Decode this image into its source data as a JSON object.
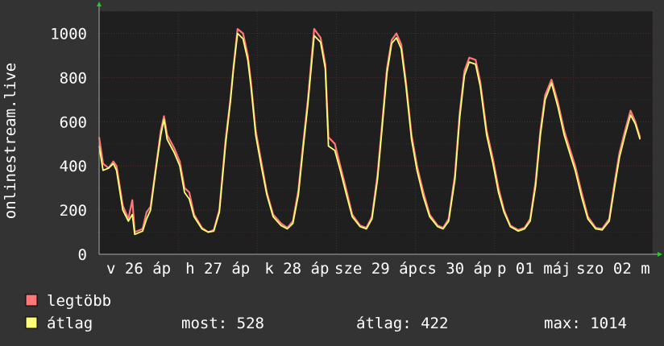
{
  "colors": {
    "background": "#333333",
    "plot_background": "#1f1f1f",
    "grid": "#5a2a2a",
    "text": "#ffffff",
    "axis_arrow": "#22cc22",
    "max_series": "#ff7777",
    "avg_series": "#ffff77"
  },
  "chart_data": {
    "type": "line",
    "ylabel": "onlinestream.live",
    "ylim": [
      0,
      1100
    ],
    "yticks": [
      "0",
      "200",
      "400",
      "600",
      "800",
      "1000"
    ],
    "xlim": [
      0,
      7
    ],
    "xtick_labels": [
      "v 26 áp",
      "h 27 áp",
      "k 28 áp",
      "sze 29 áp",
      "cs 30 áp",
      "p 01 máj",
      "szo 02 m"
    ],
    "grid": true,
    "legend_placement": "bottom",
    "series": [
      {
        "name": "legtöbb",
        "color": "#ff7777",
        "points": [
          [
            0,
            530
          ],
          [
            0.05,
            410
          ],
          [
            0.12,
            390
          ],
          [
            0.18,
            420
          ],
          [
            0.22,
            400
          ],
          [
            0.3,
            220
          ],
          [
            0.37,
            160
          ],
          [
            0.42,
            245
          ],
          [
            0.45,
            100
          ],
          [
            0.55,
            115
          ],
          [
            0.6,
            190
          ],
          [
            0.65,
            215
          ],
          [
            0.72,
            400
          ],
          [
            0.78,
            560
          ],
          [
            0.82,
            625
          ],
          [
            0.86,
            540
          ],
          [
            0.95,
            480
          ],
          [
            1.02,
            420
          ],
          [
            1.08,
            300
          ],
          [
            1.14,
            280
          ],
          [
            1.2,
            180
          ],
          [
            1.3,
            120
          ],
          [
            1.38,
            100
          ],
          [
            1.45,
            110
          ],
          [
            1.52,
            200
          ],
          [
            1.6,
            520
          ],
          [
            1.66,
            700
          ],
          [
            1.7,
            850
          ],
          [
            1.75,
            1020
          ],
          [
            1.82,
            1000
          ],
          [
            1.88,
            900
          ],
          [
            1.92,
            780
          ],
          [
            1.98,
            560
          ],
          [
            2.05,
            420
          ],
          [
            2.12,
            280
          ],
          [
            2.2,
            180
          ],
          [
            2.3,
            140
          ],
          [
            2.38,
            120
          ],
          [
            2.45,
            150
          ],
          [
            2.52,
            290
          ],
          [
            2.58,
            500
          ],
          [
            2.64,
            700
          ],
          [
            2.72,
            1020
          ],
          [
            2.8,
            980
          ],
          [
            2.86,
            860
          ],
          [
            2.9,
            530
          ],
          [
            2.98,
            500
          ],
          [
            3.05,
            400
          ],
          [
            3.12,
            300
          ],
          [
            3.2,
            180
          ],
          [
            3.3,
            130
          ],
          [
            3.38,
            120
          ],
          [
            3.45,
            170
          ],
          [
            3.52,
            360
          ],
          [
            3.58,
            600
          ],
          [
            3.64,
            840
          ],
          [
            3.7,
            970
          ],
          [
            3.76,
            1000
          ],
          [
            3.82,
            950
          ],
          [
            3.88,
            780
          ],
          [
            3.95,
            540
          ],
          [
            4.02,
            400
          ],
          [
            4.1,
            280
          ],
          [
            4.18,
            180
          ],
          [
            4.28,
            130
          ],
          [
            4.35,
            120
          ],
          [
            4.42,
            160
          ],
          [
            4.5,
            360
          ],
          [
            4.56,
            640
          ],
          [
            4.62,
            830
          ],
          [
            4.68,
            890
          ],
          [
            4.76,
            880
          ],
          [
            4.82,
            780
          ],
          [
            4.9,
            560
          ],
          [
            4.98,
            430
          ],
          [
            5.05,
            300
          ],
          [
            5.12,
            200
          ],
          [
            5.2,
            130
          ],
          [
            5.3,
            110
          ],
          [
            5.38,
            120
          ],
          [
            5.45,
            160
          ],
          [
            5.52,
            330
          ],
          [
            5.58,
            560
          ],
          [
            5.64,
            720
          ],
          [
            5.72,
            790
          ],
          [
            5.8,
            690
          ],
          [
            5.88,
            560
          ],
          [
            5.95,
            480
          ],
          [
            6.02,
            400
          ],
          [
            6.1,
            280
          ],
          [
            6.18,
            170
          ],
          [
            6.28,
            120
          ],
          [
            6.36,
            115
          ],
          [
            6.45,
            160
          ],
          [
            6.52,
            330
          ],
          [
            6.58,
            460
          ],
          [
            6.65,
            560
          ],
          [
            6.72,
            650
          ],
          [
            6.78,
            600
          ],
          [
            6.84,
            528
          ]
        ]
      },
      {
        "name": "átlag",
        "color": "#ffff77",
        "points": [
          [
            0,
            490
          ],
          [
            0.05,
            380
          ],
          [
            0.12,
            390
          ],
          [
            0.18,
            410
          ],
          [
            0.22,
            380
          ],
          [
            0.3,
            200
          ],
          [
            0.37,
            150
          ],
          [
            0.42,
            180
          ],
          [
            0.45,
            90
          ],
          [
            0.55,
            105
          ],
          [
            0.6,
            160
          ],
          [
            0.65,
            200
          ],
          [
            0.72,
            390
          ],
          [
            0.78,
            540
          ],
          [
            0.82,
            610
          ],
          [
            0.86,
            520
          ],
          [
            0.95,
            460
          ],
          [
            1.02,
            400
          ],
          [
            1.08,
            280
          ],
          [
            1.14,
            250
          ],
          [
            1.2,
            170
          ],
          [
            1.3,
            115
          ],
          [
            1.38,
            100
          ],
          [
            1.45,
            105
          ],
          [
            1.52,
            190
          ],
          [
            1.6,
            500
          ],
          [
            1.66,
            690
          ],
          [
            1.7,
            840
          ],
          [
            1.75,
            1000
          ],
          [
            1.82,
            975
          ],
          [
            1.88,
            880
          ],
          [
            1.92,
            760
          ],
          [
            1.98,
            540
          ],
          [
            2.05,
            400
          ],
          [
            2.12,
            270
          ],
          [
            2.2,
            170
          ],
          [
            2.3,
            130
          ],
          [
            2.38,
            115
          ],
          [
            2.45,
            140
          ],
          [
            2.52,
            270
          ],
          [
            2.58,
            480
          ],
          [
            2.64,
            680
          ],
          [
            2.72,
            990
          ],
          [
            2.8,
            960
          ],
          [
            2.86,
            840
          ],
          [
            2.9,
            490
          ],
          [
            2.98,
            470
          ],
          [
            3.05,
            380
          ],
          [
            3.12,
            280
          ],
          [
            3.2,
            170
          ],
          [
            3.3,
            125
          ],
          [
            3.38,
            115
          ],
          [
            3.45,
            160
          ],
          [
            3.52,
            340
          ],
          [
            3.58,
            580
          ],
          [
            3.64,
            820
          ],
          [
            3.7,
            955
          ],
          [
            3.76,
            980
          ],
          [
            3.82,
            930
          ],
          [
            3.88,
            760
          ],
          [
            3.95,
            520
          ],
          [
            4.02,
            380
          ],
          [
            4.1,
            260
          ],
          [
            4.18,
            170
          ],
          [
            4.28,
            125
          ],
          [
            4.35,
            115
          ],
          [
            4.42,
            150
          ],
          [
            4.5,
            340
          ],
          [
            4.56,
            620
          ],
          [
            4.62,
            810
          ],
          [
            4.68,
            870
          ],
          [
            4.76,
            860
          ],
          [
            4.82,
            760
          ],
          [
            4.9,
            540
          ],
          [
            4.98,
            410
          ],
          [
            5.05,
            280
          ],
          [
            5.12,
            190
          ],
          [
            5.2,
            125
          ],
          [
            5.3,
            105
          ],
          [
            5.38,
            115
          ],
          [
            5.45,
            150
          ],
          [
            5.52,
            310
          ],
          [
            5.58,
            540
          ],
          [
            5.64,
            700
          ],
          [
            5.72,
            775
          ],
          [
            5.8,
            670
          ],
          [
            5.88,
            540
          ],
          [
            5.95,
            460
          ],
          [
            6.02,
            380
          ],
          [
            6.1,
            260
          ],
          [
            6.18,
            160
          ],
          [
            6.28,
            115
          ],
          [
            6.36,
            110
          ],
          [
            6.45,
            150
          ],
          [
            6.52,
            310
          ],
          [
            6.58,
            440
          ],
          [
            6.65,
            540
          ],
          [
            6.72,
            630
          ],
          [
            6.78,
            590
          ],
          [
            6.84,
            520
          ]
        ]
      }
    ]
  },
  "legend": {
    "items": [
      {
        "label": "legtöbb",
        "color": "#ff7777"
      },
      {
        "label": "átlag",
        "color": "#ffff77"
      }
    ],
    "stats": [
      "most: 528",
      "átlag: 422",
      "max: 1014"
    ]
  }
}
